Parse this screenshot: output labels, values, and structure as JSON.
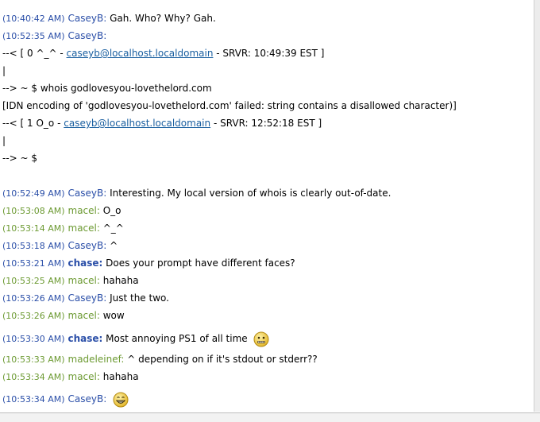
{
  "colors": {
    "self_nick": "#2b4fa8",
    "other_nick": "#6c9a32",
    "link": "#1a5fa0"
  },
  "messages": [
    {
      "ts": "(10:40:42 AM)",
      "nick": "CaseyB:",
      "text": "Gah.  Who?  Why?  Gah."
    },
    {
      "ts": "(10:52:35 AM)",
      "nick": "CaseyB:",
      "text": ""
    },
    {
      "pre": "--< [ 0 ^_^ - ",
      "link": "caseyb@localhost.localdomain",
      "post": " - SRVR: 10:49:39 EST ]"
    },
    {
      "text": "|"
    },
    {
      "text": "--> ~ $ whois godlovesyou-lovethelord.com"
    },
    {
      "text": "[IDN encoding of 'godlovesyou-lovethelord.com' failed: string contains a disallowed character)]"
    },
    {
      "pre": "--< [ 1 O_o - ",
      "link": "caseyb@localhost.localdomain",
      "post": " - SRVR: 12:52:18 EST ]"
    },
    {
      "text": "|"
    },
    {
      "text": "--> ~ $"
    },
    {
      "ts": "(10:52:49 AM)",
      "nick": "CaseyB:",
      "text": "Interesting.  My local version of whois is clearly out-of-date."
    },
    {
      "ts": "(10:53:08 AM)",
      "nick": "macel:",
      "text": "O_o"
    },
    {
      "ts": "(10:53:14 AM)",
      "nick": "macel:",
      "text": "^_^"
    },
    {
      "ts": "(10:53:18 AM)",
      "nick": "CaseyB:",
      "text": "^"
    },
    {
      "ts": "(10:53:21 AM)",
      "nick": "chase:",
      "text": "Does your prompt have different faces?"
    },
    {
      "ts": "(10:53:25 AM)",
      "nick": "macel:",
      "text": "hahaha"
    },
    {
      "ts": "(10:53:26 AM)",
      "nick": "CaseyB:",
      "text": "Just the two."
    },
    {
      "ts": "(10:53:26 AM)",
      "nick": "macel:",
      "text": "wow"
    },
    {
      "ts": "(10:53:30 AM)",
      "nick": "chase:",
      "text": "Most annoying PS1 of all time",
      "emoticon": "neutral-face-icon"
    },
    {
      "ts": "(10:53:33 AM)",
      "nick": "madeleinef:",
      "text": "^ depending on if it's stdout or stderr??"
    },
    {
      "ts": "(10:53:34 AM)",
      "nick": "macel:",
      "text": "hahaha"
    },
    {
      "ts": "(10:53:34 AM)",
      "nick": "CaseyB:",
      "text": "",
      "emoticon": "grin-face-icon"
    }
  ]
}
